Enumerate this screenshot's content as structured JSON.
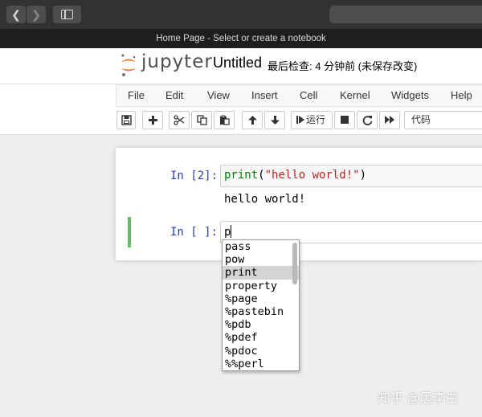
{
  "browser": {
    "back_glyph": "❮",
    "forward_glyph": "❯",
    "tab_title": "Home Page - Select or create a notebook"
  },
  "header": {
    "logo_text": "jupyter",
    "notebook_title": "Untitled",
    "checkpoint_status": "最后检查: 4 分钟前  (未保存改变)"
  },
  "menu": [
    "File",
    "Edit",
    "View",
    "Insert",
    "Cell",
    "Kernel",
    "Widgets",
    "Help"
  ],
  "toolbar": {
    "run_label": "运行",
    "cell_type": "代码",
    "icons": [
      "save-icon",
      "plus-icon",
      "scissors-icon",
      "copy-icon",
      "paste-icon",
      "arrow-up-icon",
      "arrow-down-icon",
      "step-forward-icon",
      "stop-icon",
      "restart-icon",
      "fast-forward-icon"
    ]
  },
  "cells": [
    {
      "prompt": "In [2]:",
      "code_func": "print",
      "code_open": "(",
      "code_str": "\"hello world!\"",
      "code_close": ")",
      "output": "hello world!"
    },
    {
      "prompt": "In [ ]:",
      "code": "p"
    }
  ],
  "completions": {
    "items": [
      "pass",
      "pow",
      "print",
      "property",
      "%page",
      "%pastebin",
      "%pdb",
      "%pdef",
      "%pdoc",
      "%%perl"
    ],
    "selected": "print"
  },
  "watermark": "知乎 @黑李白",
  "colors": {
    "prompt": "#303f9f",
    "keyword": "#008000",
    "string": "#ba2121",
    "selected_cell": "#66bb6a"
  }
}
